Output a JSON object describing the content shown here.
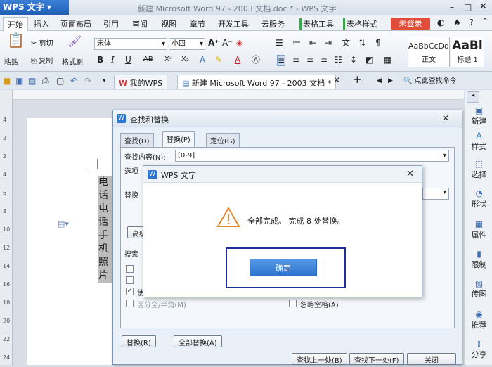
{
  "app": {
    "menu_label": "WPS 文字",
    "window_title": "新建 Microsoft Word 97 - 2003 文档.doc * - WPS 文字",
    "login_label": "未登录"
  },
  "menu": {
    "items": [
      "开始",
      "插入",
      "页面布局",
      "引用",
      "审阅",
      "视图",
      "章节",
      "开发工具",
      "云服务",
      "表格工具",
      "表格样式"
    ]
  },
  "ribbon": {
    "paste_label": "粘贴",
    "cut_label": "剪切",
    "copy_label": "复制",
    "format_painter_label": "格式刷",
    "font_name": "宋体",
    "font_size": "小四",
    "style1_preview": "AaBbCcDd",
    "style1_label": "正文",
    "style2_preview": "AaBl",
    "style2_label": "标题 1"
  },
  "tabs": {
    "my_wps": "我的WPS",
    "doc_tab": "新建 Microsoft Word 97 - 2003 文档 *",
    "search_cmd": "点此查找命令"
  },
  "document": {
    "lines": [
      "电话",
      "电话",
      "手机",
      "照片"
    ]
  },
  "right_sidebar": {
    "items": [
      "新建",
      "样式",
      "选择",
      "形状",
      "属性",
      "限制",
      "传图",
      "推荐",
      "分享"
    ]
  },
  "find_dialog": {
    "title": "查找和替换",
    "tabs": [
      "查找(D)",
      "替换(P)",
      "定位(G)"
    ],
    "find_label": "查找内容(N):",
    "find_value": "[0-9]",
    "options_label": "选项",
    "replace_label": "替换",
    "advanced_label": "高级",
    "search_label": "搜索",
    "option_halfwidth": "区分全/半角(M)",
    "option_ignore_space": "忽略空格(A)",
    "option_checked_label": "使",
    "btn_replace": "替换(R)",
    "btn_replace_all": "全部替换(A)",
    "btn_find_prev": "查找上一处(B)",
    "btn_find_next": "查找下一处(F)",
    "btn_close": "关闭"
  },
  "message_box": {
    "title": "WPS 文字",
    "message": "全部完成。 完成 8 处替换。",
    "ok_label": "确定"
  }
}
